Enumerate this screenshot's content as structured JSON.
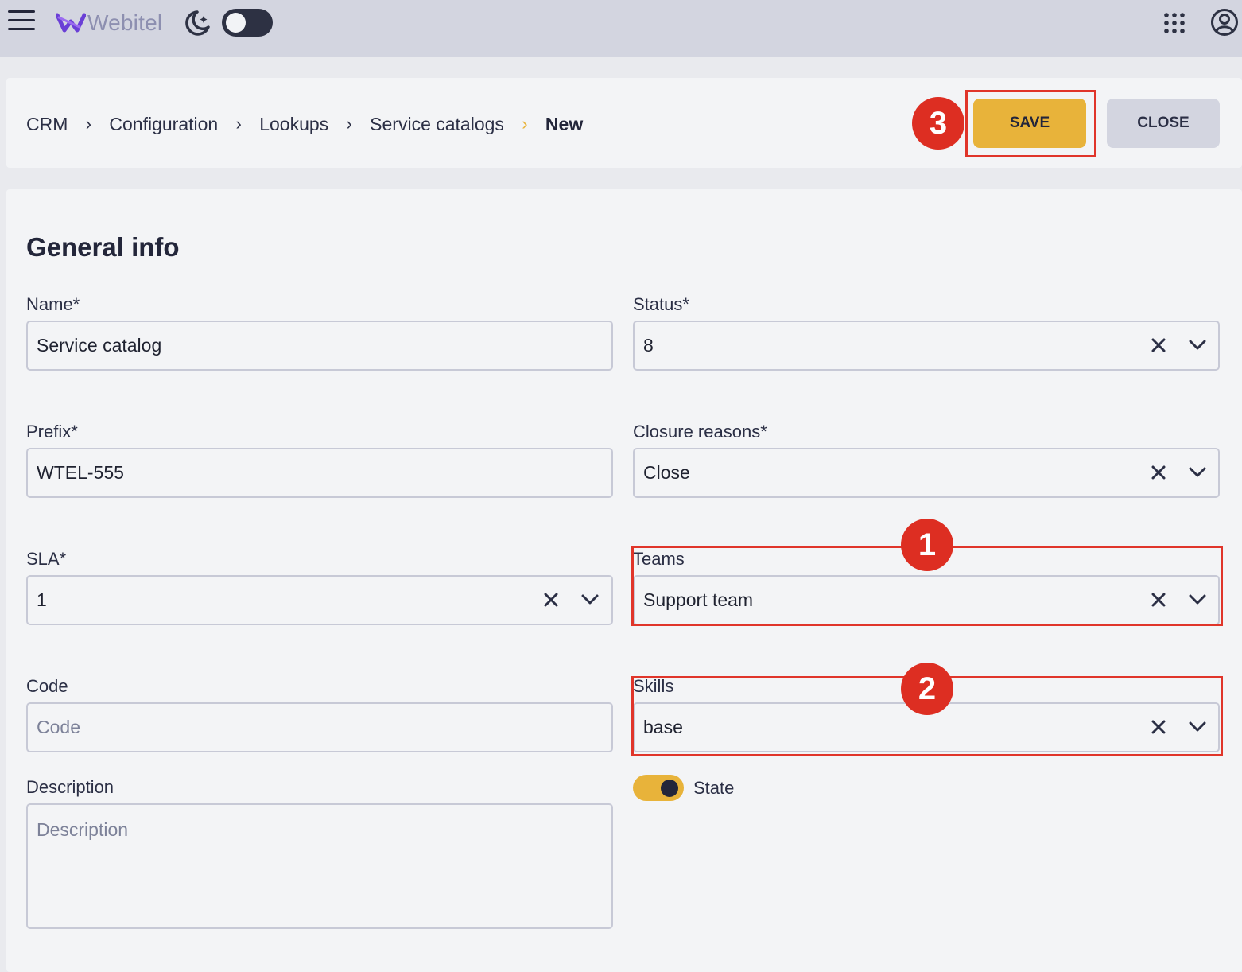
{
  "topbar": {
    "logo_text": "Webitel",
    "icons": [
      "hamburger-menu-icon",
      "webitel-logo-icon",
      "moon-stars-icon",
      "apps-grid-icon",
      "account-icon"
    ]
  },
  "breadcrumb": {
    "items": [
      "CRM",
      "Configuration",
      "Lookups",
      "Service catalogs"
    ],
    "current": "New",
    "separator": "›"
  },
  "actions": {
    "save_label": "SAVE",
    "close_label": "CLOSE"
  },
  "annotations": {
    "badge_1": "1",
    "badge_2": "2",
    "badge_3": "3"
  },
  "form": {
    "title": "General info",
    "name": {
      "label": "Name*",
      "value": "Service catalog"
    },
    "status": {
      "label": "Status*",
      "value": "8"
    },
    "prefix": {
      "label": "Prefix*",
      "value": "WTEL-555"
    },
    "closure_reasons": {
      "label": "Closure reasons*",
      "value": "Close"
    },
    "sla": {
      "label": "SLA*",
      "value": "1"
    },
    "teams": {
      "label": "Teams",
      "value": "Support team"
    },
    "code": {
      "label": "Code",
      "placeholder": "Code"
    },
    "skills": {
      "label": "Skills",
      "value": "base"
    },
    "description": {
      "label": "Description",
      "placeholder": "Description"
    },
    "state": {
      "label": "State",
      "enabled": true
    }
  },
  "colors": {
    "accent": "#e8b33a",
    "annotation_red": "#dd2e22",
    "topbar_bg": "#d3d5e0",
    "card_bg": "#f3f4f6"
  }
}
